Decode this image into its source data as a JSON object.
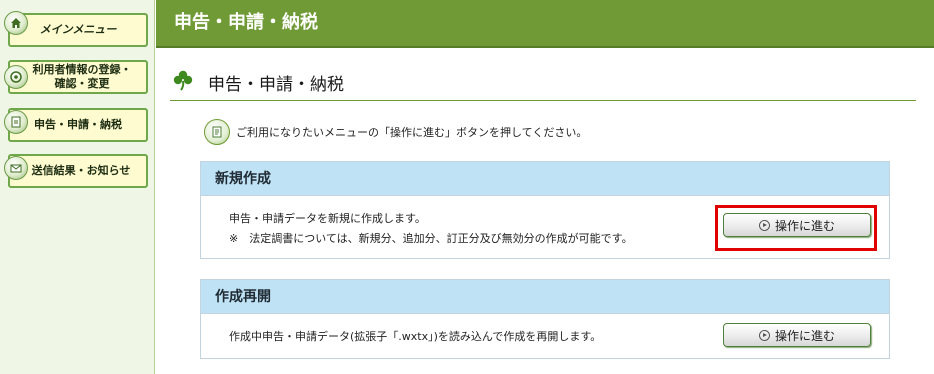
{
  "sidebar": {
    "items": [
      {
        "label": "メインメニュー",
        "icon": "home-icon"
      },
      {
        "label": "利用者情報の登録・\n確認・変更",
        "icon": "user-info-icon"
      },
      {
        "label": "申告・申請・納税",
        "icon": "document-icon"
      },
      {
        "label": "送信結果・お知らせ",
        "icon": "mail-icon"
      }
    ]
  },
  "header": {
    "title": "申告・申請・納税"
  },
  "section": {
    "title": "申告・申請・納税",
    "icon": "clover-icon"
  },
  "instruction": {
    "text": "ご利用になりたいメニューの「操作に進む」ボタンを押してください。",
    "icon": "document-icon"
  },
  "cards": [
    {
      "title": "新規作成",
      "lines": [
        "申告・申請データを新規に作成します。",
        "※　法定調書については、新規分、追加分、訂正分及び無効分の作成が可能です。"
      ],
      "button": "操作に進む"
    },
    {
      "title": "作成再開",
      "lines": [
        "作成中申告・申請データ(拡張子「.wxtx」)を読み込んで作成を再開します。"
      ],
      "button": "操作に進む"
    }
  ],
  "colors": {
    "header_green": "#6f9a35",
    "card_header_blue": "#bfe2f5",
    "highlight_red": "#e00000",
    "nav_button_bg": "#fffbd0"
  }
}
